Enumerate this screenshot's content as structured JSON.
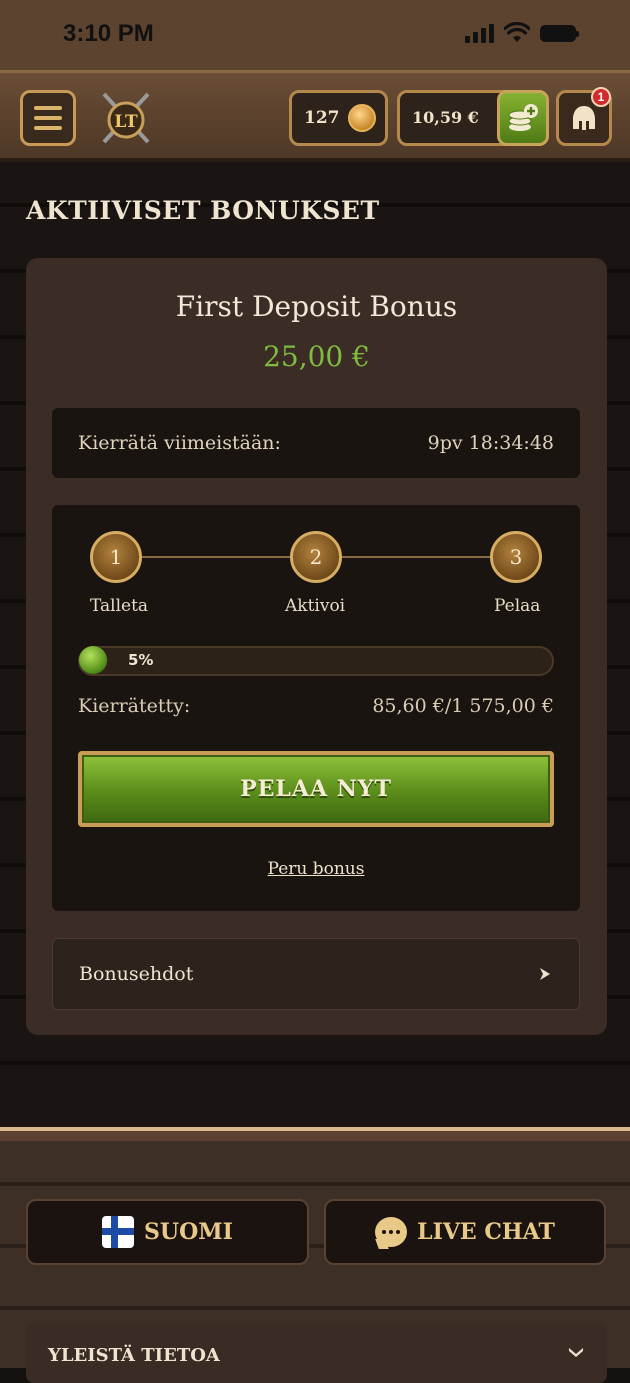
{
  "status_bar": {
    "time": "3:10 PM"
  },
  "header": {
    "coins": "127",
    "balance": "10,59 €",
    "notification_count": "1"
  },
  "page": {
    "title": "AKTIIVISET BONUKSET"
  },
  "bonus": {
    "name": "First Deposit Bonus",
    "amount": "25,00 €",
    "expiry_label": "Kierrätä viimeistään:",
    "expiry_value": "9pv 18:34:48",
    "steps": [
      {
        "number": "1",
        "label": "Talleta"
      },
      {
        "number": "2",
        "label": "Aktivoi"
      },
      {
        "number": "3",
        "label": "Pelaa"
      }
    ],
    "progress_percent": 5,
    "progress_label": "5%",
    "wagered_label": "Kierrätetty:",
    "wagered_value": "85,60 €/1 575,00 €",
    "play_button": "PELAA NYT",
    "cancel_link": "Peru bonus",
    "terms_label": "Bonusehdot"
  },
  "footer": {
    "language_button": "SUOMI",
    "chat_button": "LIVE CHAT",
    "info_section": "YLEISTÄ TIETOA"
  },
  "colors": {
    "accent_green": "#7fbb3f",
    "gold": "#c99c58",
    "card": "#3b2d25"
  }
}
